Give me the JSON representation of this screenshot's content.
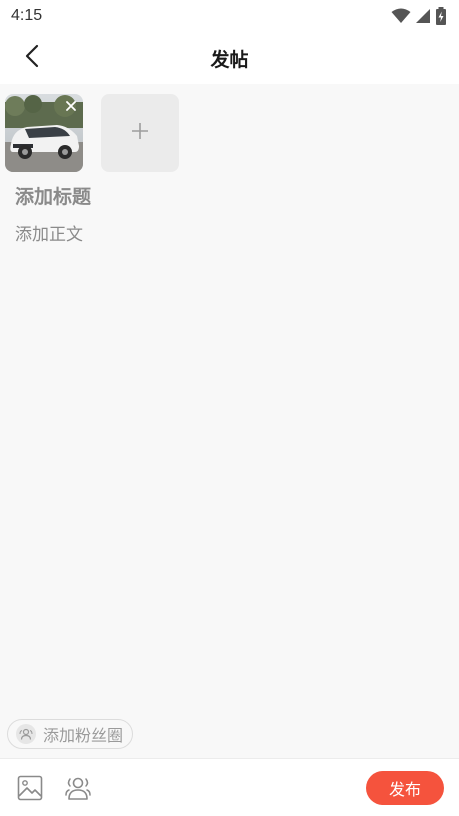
{
  "status_bar": {
    "time": "4:15",
    "icons": [
      "wifi-icon",
      "cellular-signal-icon",
      "battery-charging-icon"
    ]
  },
  "nav": {
    "back_icon": "chevron-left-icon",
    "title": "发帖"
  },
  "images": {
    "attached": [
      {
        "description_icon": "car-photo",
        "remove_icon": "close-icon"
      }
    ],
    "add_icon": "plus-icon"
  },
  "editor": {
    "title_placeholder": "添加标题",
    "title_value": "",
    "body_placeholder": "添加正文",
    "body_value": ""
  },
  "fan_circle": {
    "icon": "people-icon",
    "label": "添加粉丝圈"
  },
  "toolbar": {
    "image_icon": "image-icon",
    "fans_icon": "group-icon",
    "publish_label": "发布"
  },
  "colors": {
    "accent": "#f5533d",
    "background": "#f8f8f8",
    "placeholder": "#8a8a8a"
  }
}
